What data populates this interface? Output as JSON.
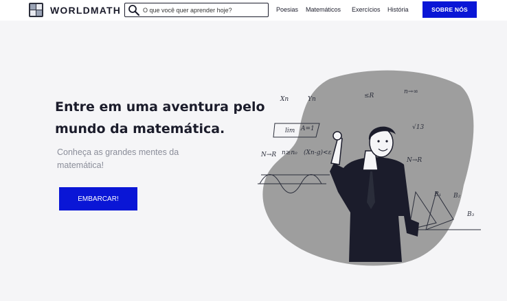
{
  "header": {
    "brand": "WORLDMATH",
    "logo_icon": "worldmath-logo-icon",
    "search": {
      "placeholder": "O que você quer aprender hoje?",
      "value": "",
      "icon": "search-icon"
    },
    "nav": [
      {
        "label": "Poesias"
      },
      {
        "label": "Matemáticos"
      },
      {
        "label": "Exercícios"
      },
      {
        "label": "História"
      }
    ],
    "cta_label": "SOBRE NÓS"
  },
  "hero": {
    "headline_line1": "Entre em uma aventura pelo",
    "headline_line2": "mundo da matemática.",
    "subtitle": "Conheça as grandes mentes da matemática!",
    "cta_label": "EMBARCAR!",
    "illustration": "teacher-pointing-at-math-formulas-illustration",
    "formula_fragments": [
      "n→∞",
      "Xn",
      "Yn",
      "≤R",
      "lim",
      "A=1",
      "N→R",
      "n≥n₀",
      "(Xn-g)<ε",
      "√13",
      "N→R",
      "B₁",
      "B₂",
      "B₃"
    ]
  },
  "colors": {
    "accent": "#0a16d6",
    "text_dark": "#1b1c2b",
    "text_muted": "#8a8d99",
    "page_bg": "#f5f5f7",
    "blob": "#9e9e9e"
  }
}
